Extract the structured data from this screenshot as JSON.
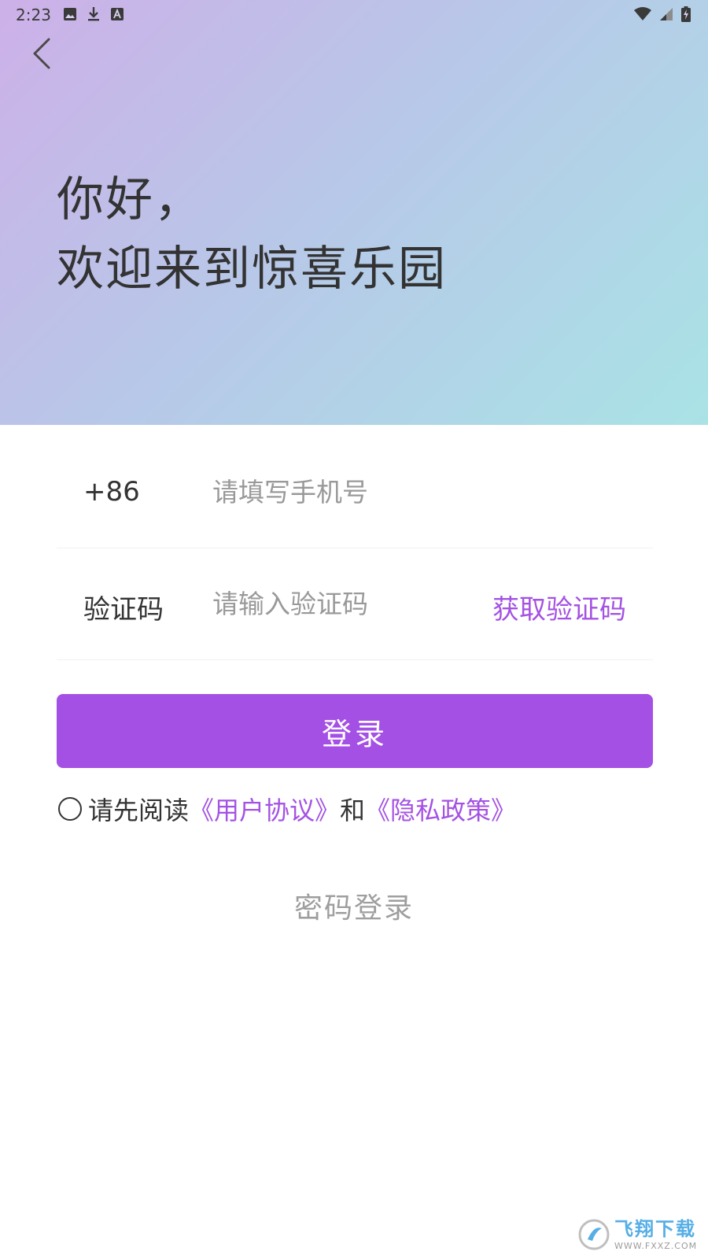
{
  "status_bar": {
    "time": "2:23",
    "left_icons": [
      "image-icon",
      "download-icon",
      "font-icon"
    ],
    "right_icons": [
      "wifi-icon",
      "signal-icon",
      "battery-charging-icon"
    ]
  },
  "header": {
    "back_icon": "chevron-left-icon",
    "greeting_line1": "你好，",
    "greeting_line2": "欢迎来到惊喜乐园",
    "gradient_colors": [
      "#cdb0e8",
      "#b8c7e8",
      "#a9e3e6"
    ]
  },
  "form": {
    "phone": {
      "country_code": "+86",
      "placeholder": "请填写手机号",
      "value": ""
    },
    "code": {
      "label": "验证码",
      "placeholder": "请输入验证码",
      "value": "",
      "get_code_label": "获取验证码"
    }
  },
  "login_button": {
    "label": "登录",
    "color": "#a450e4"
  },
  "agreement": {
    "checked": false,
    "prefix": "请先阅读",
    "user_agreement": "《用户协议》",
    "and": "和",
    "privacy_policy": "《隐私政策》",
    "link_color": "#a452e3"
  },
  "password_login": {
    "label": "密码登录"
  },
  "watermark": {
    "main": "飞翔下载",
    "sub": "WWW.FXXZ.COM"
  }
}
